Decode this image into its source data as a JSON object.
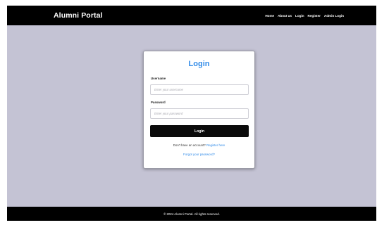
{
  "navbar": {
    "brand": "Alumni Portal",
    "links": [
      "Home",
      "About us",
      "Login",
      "Register",
      "Admin Login"
    ]
  },
  "login": {
    "title": "Login",
    "username_label": "Username",
    "username_placeholder": "Enter your username",
    "password_label": "Password",
    "password_placeholder": "Enter your password",
    "button_label": "Login",
    "signup_prompt": "Don't have an account?",
    "signup_link": "Register here",
    "forgot_link": "Forgot your password?"
  },
  "footer": {
    "text": "© 2024 Alumni Portal. All rights reserved."
  },
  "colors": {
    "accent": "#2f8ae8",
    "page_background": "#c4c3d4",
    "navbar_background": "#000000",
    "button_background": "#0b0b0b"
  }
}
